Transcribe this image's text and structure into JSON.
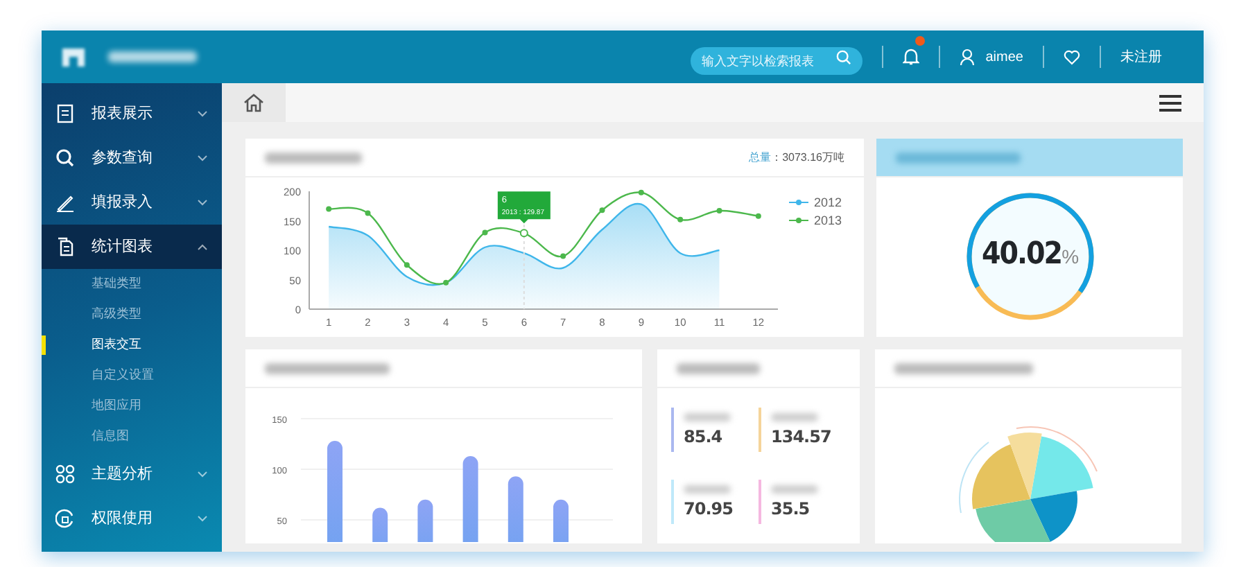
{
  "header": {
    "search": {
      "placeholder": "输入文字以检索报表"
    },
    "notification_badge": true,
    "user": "aimee",
    "register_link": "未注册"
  },
  "sidebar": {
    "items": [
      {
        "label": "报表展示",
        "expanded": false,
        "selected": false
      },
      {
        "label": "参数查询",
        "expanded": false,
        "selected": false
      },
      {
        "label": "填报录入",
        "expanded": false,
        "selected": false
      },
      {
        "label": "统计图表",
        "expanded": true,
        "selected": true,
        "children": [
          {
            "label": "基础类型",
            "selected": false
          },
          {
            "label": "高级类型",
            "selected": false
          },
          {
            "label": "图表交互",
            "selected": true
          },
          {
            "label": "自定义设置",
            "selected": false
          },
          {
            "label": "地图应用",
            "selected": false
          },
          {
            "label": "信息图",
            "selected": false
          }
        ]
      },
      {
        "label": "主题分析",
        "expanded": false,
        "selected": false
      },
      {
        "label": "权限使用",
        "expanded": false,
        "selected": false
      }
    ]
  },
  "line_card": {
    "total_label": "总量",
    "total_value": "：3073.16万吨",
    "chart_data": {
      "type": "line",
      "x": [
        1,
        2,
        3,
        4,
        5,
        6,
        7,
        8,
        9,
        10,
        11,
        12
      ],
      "xlim": [
        0.5,
        12.5
      ],
      "legend": "right",
      "xticks": [
        1,
        2,
        3,
        4,
        5,
        6,
        7,
        8,
        9,
        10,
        11,
        12
      ],
      "yticks": [
        0,
        50,
        100,
        150,
        200
      ],
      "ylim": [
        0,
        200
      ],
      "series": [
        {
          "name": "2012",
          "color": "#3fb6ea",
          "type": "area",
          "marker": false,
          "values": [
            140,
            125,
            55,
            45,
            105,
            95,
            70,
            135,
            178,
            95,
            100,
            null
          ]
        },
        {
          "name": "2013",
          "color": "#4cb84c",
          "marker": true,
          "values": [
            170,
            163,
            75,
            45,
            130,
            129,
            90,
            168,
            198,
            152,
            167,
            158
          ]
        }
      ],
      "annotations": [
        "6",
        "2013 : 129.87"
      ]
    }
  },
  "gauge": {
    "value": "40.02",
    "unit": "%",
    "level": 0.68
  },
  "bar_card": {
    "chart_data": {
      "type": "bar",
      "grid": true,
      "series": [
        {
          "color": "#8ea4f5",
          "values": [
            128,
            62,
            70,
            113,
            93,
            70
          ]
        }
      ],
      "yticks": [
        50,
        100,
        150
      ],
      "ylim": [
        0,
        150
      ]
    }
  },
  "stats": [
    {
      "value": "85.4",
      "color": "#aab8f0"
    },
    {
      "value": "134.57",
      "color": "#f5d49a"
    },
    {
      "value": "70.95",
      "color": "#bfe9fa"
    },
    {
      "value": "35.5",
      "color": "#f5b8e0"
    }
  ]
}
